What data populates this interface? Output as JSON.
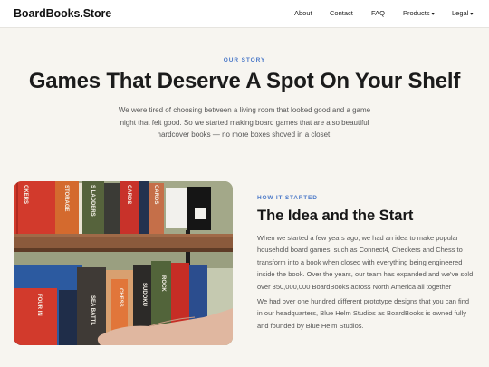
{
  "header": {
    "logo": "BoardBooks.Store",
    "nav": [
      {
        "label": "About"
      },
      {
        "label": "Contact"
      },
      {
        "label": "FAQ"
      },
      {
        "label": "Products",
        "dropdown": true
      },
      {
        "label": "Legal",
        "dropdown": true
      }
    ],
    "caret_glyph": "▾"
  },
  "hero": {
    "eyebrow": "OUR STORY",
    "title": "Games That Deserve A Spot On Your Shelf",
    "description": "We were tired of choosing between a living room that looked good and a game night that felt good. So we started making board games that are also beautiful hardcover books — no more boxes shoved in a closet."
  },
  "story": {
    "eyebrow": "HOW IT STARTED",
    "title": "The Idea and the Start",
    "paragraph_1": "When we started a few years ago, we had an idea to make popular household board games, such as Connect4, Checkers and Chess to transform into a book when closed with everything being engineered inside the book. Over the years, our team has expanded and we've sold over 350,000,000 BoardBooks across North America all together",
    "paragraph_2": "We had over one hundred different prototype designs that you can find in our headquarters, Blue Helm Studios as BoardBooks is owned fully and founded by Blue Helm Studios."
  },
  "photo": {
    "spine_labels": [
      "CKERS",
      "STORAGE",
      "S LADDERS",
      "CARDS",
      "CARDS",
      "FOUR IN",
      "SEA BATTL",
      "CHESS",
      "SUDOKU",
      "ROCK"
    ],
    "colors": {
      "shelf_wood": "#8b5a3c",
      "wall": "#a3a889",
      "red": "#d23a2c",
      "navy": "#23324f",
      "blue": "#2c5aa0",
      "olive": "#5b6b3a",
      "skin": "#e0b7a0"
    }
  },
  "colors": {
    "accent": "#4b79c8",
    "background": "#f7f5f0"
  }
}
